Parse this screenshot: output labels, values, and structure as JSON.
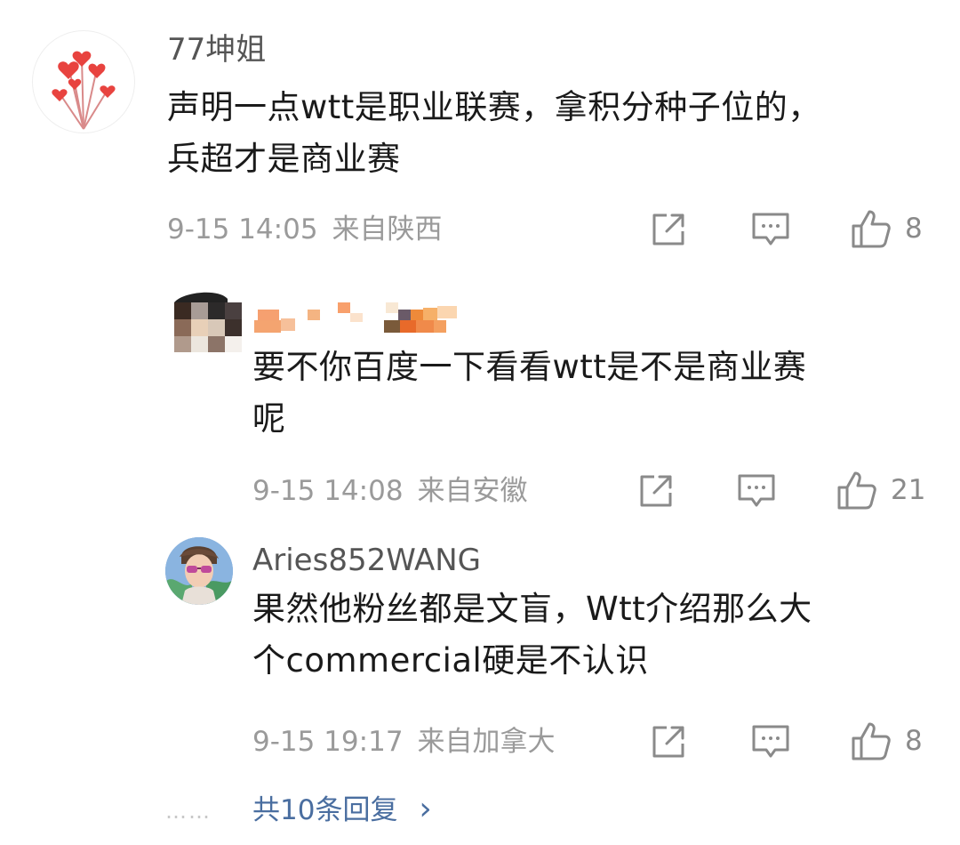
{
  "comments": [
    {
      "username": "77坤姐",
      "text_lines": [
        "声明一点wtt是职业联赛，拿积分种子位的，",
        "兵超才是商业赛"
      ],
      "date": "9-15 14:05",
      "location": "来自陕西",
      "likes": "8",
      "avatar_icon": "heart-balloons-avatar"
    },
    {
      "username": "",
      "text_lines": [
        "要不你百度一下看看wtt是不是商业赛",
        "呢"
      ],
      "date": "9-15 14:08",
      "location": "来自安徽",
      "likes": "21",
      "avatar_icon": "pixelated-avatar"
    },
    {
      "username": "Aries852WANG",
      "text_lines": [
        "果然他粉丝都是文盲，Wtt介绍那么大",
        "个commercial硬是不认识"
      ],
      "date": "9-15 19:17",
      "location": "来自加拿大",
      "likes": "8",
      "avatar_icon": "person-photo-avatar"
    }
  ],
  "more_replies": {
    "dots": "……",
    "label": "共10条回复",
    "chevron": "›"
  },
  "colors": {
    "meta_gray": "#9a9a9a",
    "link_blue": "#4a6ea0",
    "username_gray": "#555555"
  }
}
